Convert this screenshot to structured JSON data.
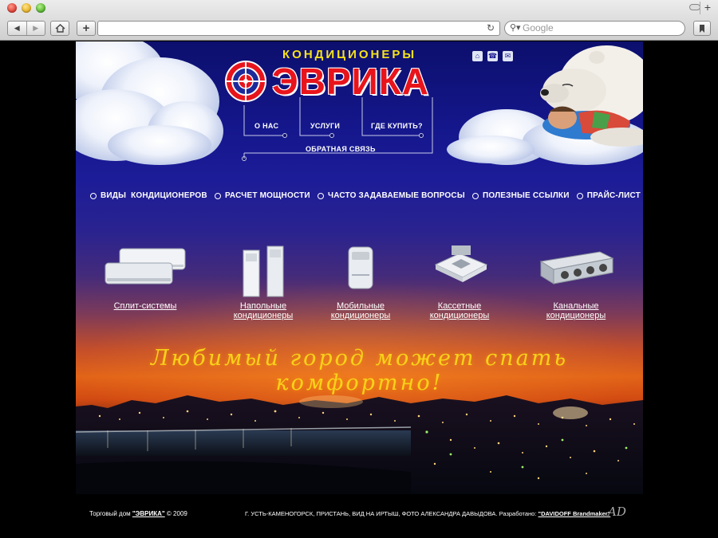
{
  "browser": {
    "search_placeholder": "Google",
    "url": "",
    "tab_plus": "+"
  },
  "header": {
    "subtitle": "КОНДИЦИОНЕРЫ",
    "brand": "ЭВРИКА",
    "links": [
      "О НАС",
      "УСЛУГИ",
      "ГДЕ КУПИТЬ?",
      "ОБРАТНАЯ СВЯЗЬ"
    ],
    "top_icons": [
      "home-icon",
      "phone-icon",
      "mail-icon"
    ]
  },
  "menu": [
    "ВИДЫ  КОНДИЦИОНЕРОВ",
    "РАСЧЕТ МОЩНОСТИ",
    "ЧАСТО ЗАДАВАЕМЫЕ ВОПРОСЫ",
    "ПОЛЕЗНЫЕ ССЫЛКИ",
    "ПРАЙС-ЛИСТ"
  ],
  "products": [
    {
      "line1": "Сплит-системы",
      "line2": ""
    },
    {
      "line1": "Напольные",
      "line2": "кондиционеры"
    },
    {
      "line1": "Мобильные",
      "line2": "кондиционеры"
    },
    {
      "line1": "Кассетные",
      "line2": "кондиционеры"
    },
    {
      "line1": "Канальные",
      "line2": "кондиционеры"
    }
  ],
  "slogan": "Любимый город может спать комфортно!",
  "footer": {
    "left_prefix": "Торговый дом ",
    "left_brand": "\"ЭВРИКА\"",
    "left_suffix": " © 2009",
    "right_text": "Г. УСТЬ-КАМЕНОГОРСК, ПРИСТАНЬ, ВИД НА ИРТЫШ, ФОТО АЛЕКСАНДРА ДАВЫДОВА. Разработано: ",
    "right_dev": "\"DAVIDOFF Brandmaker\"",
    "signature": "AD"
  },
  "colors": {
    "brand_red": "#e8141c",
    "subtitle_yellow": "#f7e21a",
    "sky_top": "#0c0f6c",
    "sunset_orange": "#e26418"
  }
}
